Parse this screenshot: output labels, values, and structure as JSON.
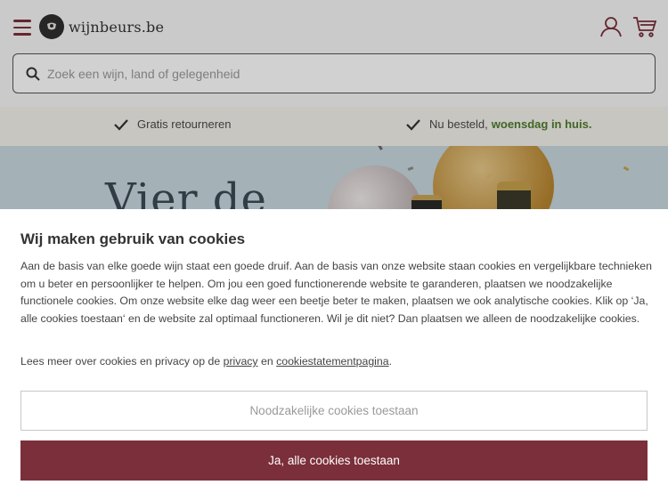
{
  "header": {
    "logo_text": "wijnbeurs.be",
    "search_placeholder": "Zoek een wijn, land of gelegenheid"
  },
  "usp": {
    "item1": "Gratis retourneren",
    "item2_prefix": "Nu besteld,",
    "item2_strong": "woensdag in huis."
  },
  "hero": {
    "title": "Vier de"
  },
  "cookie": {
    "title": "Wij maken gebruik van cookies",
    "body": "Aan de basis van elke goede wijn staat een goede druif. Aan de basis van onze website staan cookies en vergelijkbare technieken om u beter en persoonlijker te helpen. Om jou een goed functionerende website te garanderen, plaatsen we noodzakelijke functionele cookies. Om onze website elke dag weer een beetje beter te maken, plaatsen we ook analytische cookies. Klik op ‘Ja, alle cookies toestaan‘ en de website zal optimaal functioneren. Wil je dit niet? Dan plaatsen we alleen de noodzakelijke cookies.",
    "more_prefix": "Lees meer over cookies en privacy op de",
    "privacy_link": "privacy",
    "more_and": "en",
    "statement_link": "cookiestatementpagina",
    "more_suffix": ".",
    "btn_necessary": "Noodzakelijke cookies toestaan",
    "btn_all": "Ja, alle cookies toestaan"
  },
  "colors": {
    "brand": "#7b2f3a",
    "usp_green": "#4f7d2e",
    "usp_bg": "#f3f2ec"
  },
  "icons": [
    "menu-icon",
    "logo-icon",
    "user-icon",
    "cart-icon",
    "search-icon",
    "check-icon"
  ]
}
